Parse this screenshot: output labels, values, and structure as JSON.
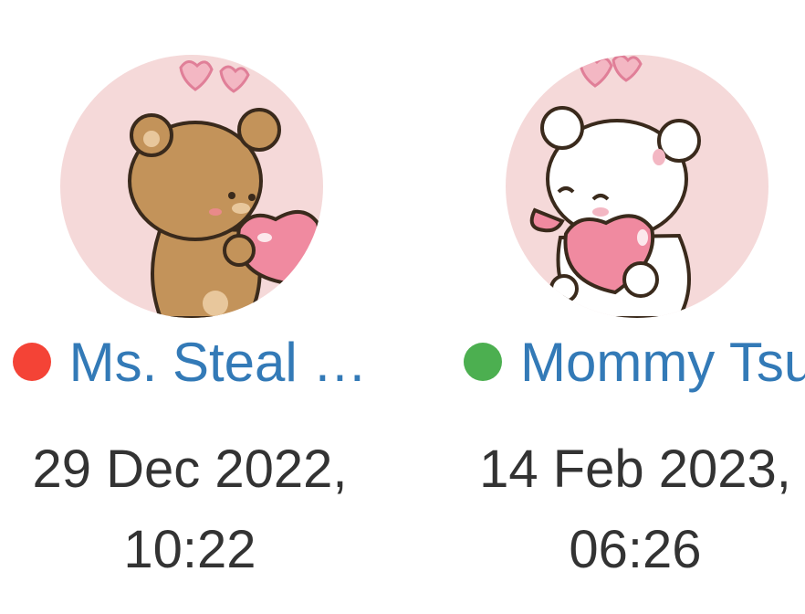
{
  "users": [
    {
      "name": "Ms. Steal …",
      "status_color": "#f44336",
      "avatar_icon": "brown-bear-holding-heart-avatar",
      "date": "29 Dec 2022,",
      "time": "10:22"
    },
    {
      "name": "Mommy Tsu",
      "status_color": "#4caf50",
      "avatar_icon": "white-bear-hugging-heart-avatar",
      "date": "14 Feb 2023,",
      "time": "06:26"
    }
  ],
  "colors": {
    "link": "#337ab7",
    "text": "#333333",
    "avatar_bg": "#f5d9d9",
    "heart": "#f08aa0"
  }
}
